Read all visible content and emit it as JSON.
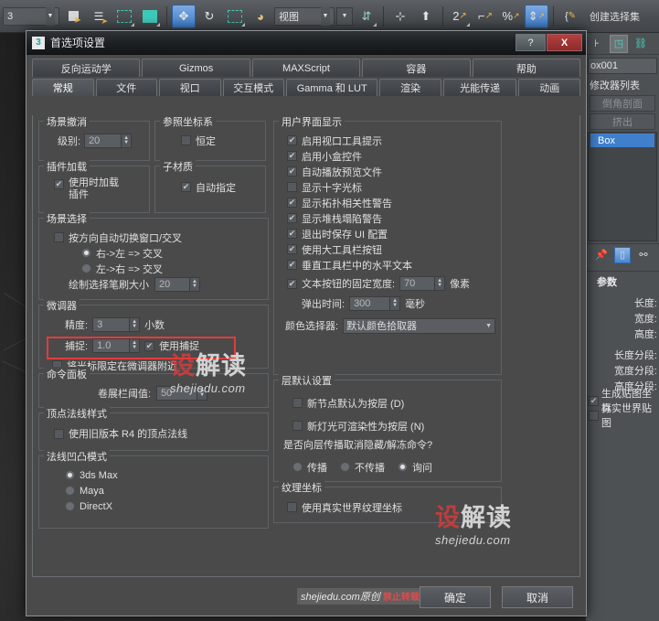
{
  "toolbar": {
    "view_combo": "视图",
    "create_selection_set": "创建选择集",
    "items": [
      {
        "name": "select-object-icon",
        "glyph": "▣"
      },
      {
        "name": "select-by-name-icon",
        "glyph": "☰"
      },
      {
        "name": "rectangular-selection-region-icon",
        "glyph": "▢"
      },
      {
        "name": "window-crossing-icon",
        "glyph": "▣"
      },
      {
        "name": "select-and-move-icon",
        "glyph": "✥"
      },
      {
        "name": "select-and-rotate-icon",
        "glyph": "↻"
      },
      {
        "name": "select-and-scale-icon",
        "glyph": "▱"
      },
      {
        "name": "select-and-manipulate-icon",
        "glyph": "◕"
      },
      {
        "name": "snap-toggle-icon",
        "glyph": "⊹"
      },
      {
        "name": "angle-snap-icon",
        "glyph": "⌖"
      },
      {
        "name": "percent-snap-icon",
        "glyph": "%"
      },
      {
        "name": "spinner-snap-icon",
        "glyph": "⇕"
      },
      {
        "name": "edit-named-selection-icon",
        "glyph": "{✎"
      }
    ]
  },
  "dialog": {
    "title": "首选项设置",
    "icon_label": "3",
    "help_button": "?",
    "close_button": "X",
    "tabs_row1": [
      "反向运动学",
      "Gizmos",
      "MAXScript",
      "容器",
      "帮助"
    ],
    "tabs_row2": [
      "常规",
      "文件",
      "视口",
      "交互模式",
      "Gamma 和 LUT",
      "渲染",
      "光能传递",
      "动画"
    ],
    "active_tab": "常规",
    "ok_button": "确定",
    "cancel_button": "取消",
    "highlight_color": "#e33b3b"
  },
  "left": {
    "scene_undo": {
      "title": "场景撤消",
      "level_label": "级别:",
      "level_value": "20"
    },
    "ref_coord": {
      "title": "参照坐标系",
      "constant_label": "恒定",
      "constant_checked": false
    },
    "plugin_loading": {
      "title": "插件加载",
      "defer_label_line1": "使用时加载",
      "defer_label_line2": "插件",
      "defer_checked": true
    },
    "sub_material": {
      "title": "子材质",
      "auto_assign_label": "自动指定",
      "auto_assign_checked": true
    },
    "scene_selection": {
      "title": "场景选择",
      "auto_window_label": "按方向自动切换窗口/交叉",
      "auto_window_checked": false,
      "option_right_left": "右->左 => 交叉",
      "option_right_left_selected": true,
      "option_left_right": "左->右 => 交叉",
      "option_left_right_selected": false,
      "brush_label": "绘制选择笔刷大小",
      "brush_value": "20"
    },
    "spinners": {
      "title": "微调器",
      "precision_label": "精度:",
      "precision_value": "3",
      "precision_suffix": "小数",
      "snap_label": "捕捉:",
      "snap_value": "1.0",
      "use_snap_label": "使用捕捉",
      "use_snap_checked": true,
      "wrap_cursor_label": "将光标限定在微调器附近",
      "wrap_cursor_checked": false
    },
    "command_panel": {
      "title": "命令面板",
      "rollout_label": "卷展栏阈值:",
      "rollout_value": "50"
    },
    "vertex_normal": {
      "title": "顶点法线样式",
      "legacy_label": "使用旧版本 R4 的顶点法线",
      "legacy_checked": false
    },
    "normal_bump": {
      "title": "法线凹凸模式",
      "options": [
        {
          "label": "3ds Max",
          "selected": true
        },
        {
          "label": "Maya",
          "selected": false
        },
        {
          "label": "DirectX",
          "selected": false
        }
      ]
    }
  },
  "right": {
    "ui_display": {
      "title": "用户界面显示",
      "checks": [
        {
          "label": "启用视口工具提示",
          "checked": true
        },
        {
          "label": "启用小盒控件",
          "checked": true
        },
        {
          "label": "自动播放预览文件",
          "checked": true
        },
        {
          "label": "显示十字光标",
          "checked": false
        },
        {
          "label": "显示拓扑相关性警告",
          "checked": true
        },
        {
          "label": "显示堆栈塌陷警告",
          "checked": true
        },
        {
          "label": "退出时保存 UI 配置",
          "checked": true
        },
        {
          "label": "使用大工具栏按钮",
          "checked": true
        },
        {
          "label": "垂直工具栏中的水平文本",
          "checked": true
        }
      ],
      "fixed_width_label": "文本按钮的固定宽度:",
      "fixed_width_checked": true,
      "fixed_width_value": "70",
      "fixed_width_suffix": "像素",
      "popup_label": "弹出时间:",
      "popup_value": "300",
      "popup_suffix": "毫秒",
      "color_picker_label": "颜色选择器:",
      "color_picker_value": "默认颜色拾取器"
    },
    "layer_defaults": {
      "title": "层默认设置",
      "new_node_label": "新节点默认为按层 (D)",
      "new_node_checked": false,
      "new_light_label": "新灯光可渲染性为按层 (N)",
      "new_light_checked": false,
      "question": "是否向层传播取消隐藏/解冻命令?",
      "options": [
        {
          "label": "传播",
          "selected": false
        },
        {
          "label": "不传播",
          "selected": false
        },
        {
          "label": "询问",
          "selected": true
        }
      ]
    },
    "texture_coords": {
      "title": "纹理坐标",
      "real_world_label": "使用真实世界纹理坐标",
      "real_world_checked": false
    }
  },
  "command_panel": {
    "object_name": "ox001",
    "modifier_list": "修改器列表",
    "modifier_buttons": [
      "倒角剖面",
      "挤出"
    ],
    "stack_items": [
      {
        "label": "Box",
        "selected": true
      }
    ],
    "rollout_title": "参数",
    "fields": [
      "长度:",
      "宽度:",
      "高度:",
      "长度分段:",
      "宽度分段:",
      "高度分段:"
    ],
    "checks": [
      {
        "label": "生成贴图坐标",
        "checked": true
      },
      {
        "label": "真实世界贴图",
        "checked": false
      }
    ]
  },
  "watermarks": {
    "logo_red": "设",
    "logo_white": "解读",
    "domain": "shejiedu.com",
    "bottom_text": "shejiedu.com原创",
    "bottom_red": "禁止转载"
  }
}
